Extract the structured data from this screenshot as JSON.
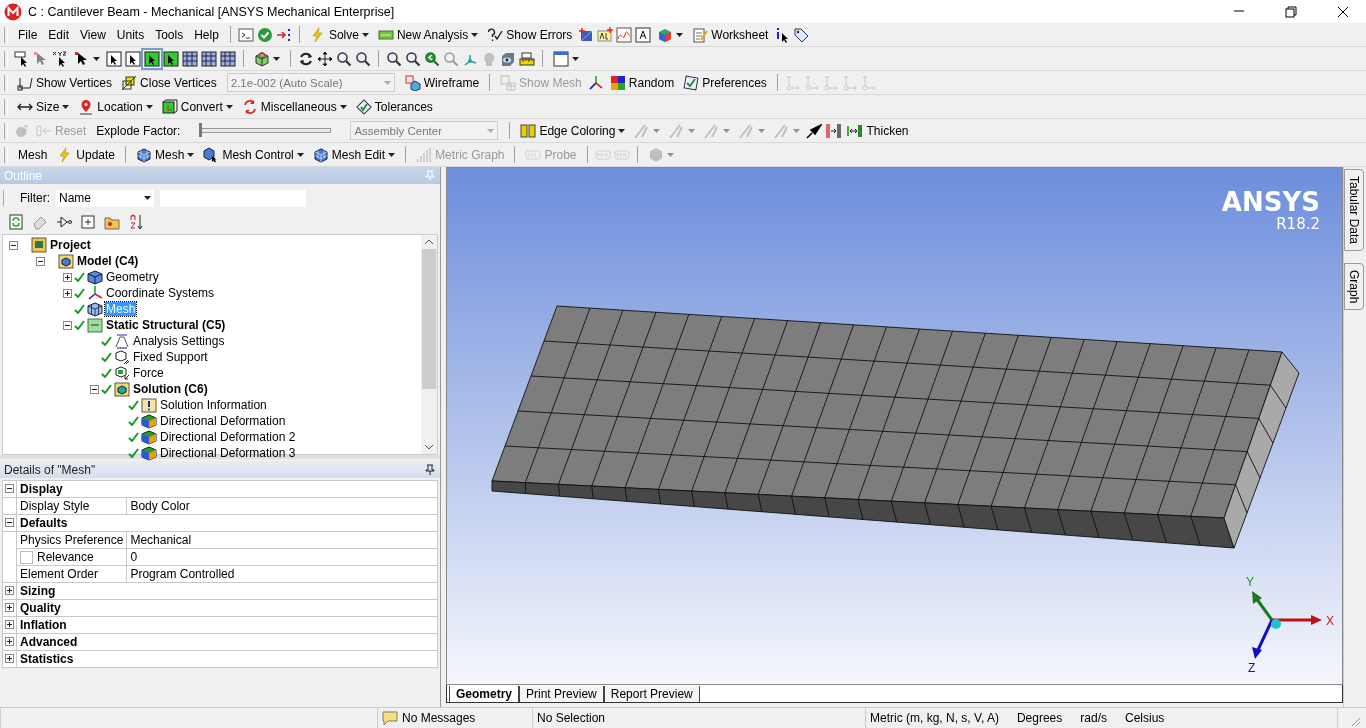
{
  "window": {
    "title": "C : Cantilever Beam - Mechanical [ANSYS Mechanical Enterprise]"
  },
  "toolbars": [
    [
      {
        "kind": "menu",
        "label": "File"
      },
      {
        "kind": "menu",
        "label": "Edit"
      },
      {
        "kind": "menu",
        "label": "View"
      },
      {
        "kind": "menu",
        "label": "Units"
      },
      {
        "kind": "menu",
        "label": "Tools"
      },
      {
        "kind": "menu",
        "label": "Help"
      },
      {
        "kind": "sep"
      },
      {
        "kind": "terminal"
      },
      {
        "kind": "check"
      },
      {
        "kind": "arrows"
      },
      {
        "kind": "sep"
      },
      {
        "kind": "lightning",
        "label": "Solve",
        "caret": true
      },
      {
        "kind": "analysis",
        "label": "New Analysis",
        "caret": true
      },
      {
        "kind": "errors",
        "label": "Show Errors"
      },
      {
        "kind": "annotate"
      },
      {
        "kind": "abc"
      },
      {
        "kind": "graph"
      },
      {
        "kind": "textframe"
      },
      {
        "kind": "colorcube",
        "caret": true
      },
      {
        "kind": "worksheet",
        "label": "Worksheet"
      },
      {
        "kind": "info"
      },
      {
        "kind": "tag"
      }
    ],
    [
      {
        "kind": "labelcursor"
      },
      {
        "kind": "pointer",
        "disabled": true
      },
      {
        "kind": "xyzcursor"
      },
      {
        "kind": "pointer",
        "caret": true
      },
      {
        "kind": "cursorbox"
      },
      {
        "kind": "cursorbox"
      },
      {
        "kind": "greenbox",
        "selected": true
      },
      {
        "kind": "greenbox"
      },
      {
        "kind": "meshbox"
      },
      {
        "kind": "meshbox"
      },
      {
        "kind": "meshbox"
      },
      {
        "kind": "sep"
      },
      {
        "kind": "cube",
        "caret": true
      },
      {
        "kind": "sep"
      },
      {
        "kind": "rotate"
      },
      {
        "kind": "pan"
      },
      {
        "kind": "magnifier"
      },
      {
        "kind": "magnifier"
      },
      {
        "kind": "sep"
      },
      {
        "kind": "magnifier"
      },
      {
        "kind": "magnifier"
      },
      {
        "kind": "zoomfit"
      },
      {
        "kind": "magnifier",
        "disabled": true
      },
      {
        "kind": "iso"
      },
      {
        "kind": "head",
        "disabled": true
      },
      {
        "kind": "eyebox"
      },
      {
        "kind": "ruler"
      },
      {
        "kind": "sep"
      },
      {
        "kind": "window",
        "caret": true
      }
    ],
    [
      {
        "kind": "vertices",
        "label": "Show Vertices"
      },
      {
        "kind": "closevert",
        "label": "Close Vertices"
      },
      {
        "kind": "combo",
        "value": "2.1e-002 (Auto Scale)",
        "disabled": true
      },
      {
        "kind": "wireframe",
        "label": "Wireframe"
      },
      {
        "kind": "sep"
      },
      {
        "kind": "showmesh",
        "label": "Show Mesh",
        "disabled": true
      },
      {
        "kind": "triad"
      },
      {
        "kind": "random",
        "label": "Random"
      },
      {
        "kind": "prefs",
        "label": "Preferences"
      },
      {
        "kind": "sep"
      },
      {
        "kind": "axisdot",
        "disabled": true
      },
      {
        "kind": "axisdot",
        "disabled": true
      },
      {
        "kind": "axisdot",
        "disabled": true
      },
      {
        "kind": "axisdot",
        "disabled": true
      },
      {
        "kind": "axisdot",
        "disabled": true
      }
    ],
    [
      {
        "kind": "size",
        "label": "Size",
        "caret": true
      },
      {
        "kind": "location",
        "label": "Location",
        "caret": true
      },
      {
        "kind": "convert",
        "label": "Convert",
        "caret": true
      },
      {
        "kind": "misc",
        "label": "Miscellaneous",
        "caret": true
      },
      {
        "kind": "tolerance",
        "label": "Tolerances"
      }
    ],
    [
      {
        "kind": "explode",
        "disabled": true
      },
      {
        "kind": "reset",
        "label": "Reset",
        "disabled": true
      },
      {
        "kind": "text",
        "label": "Explode Factor:"
      },
      {
        "kind": "slider",
        "level": 0
      },
      {
        "kind": "combo",
        "value": "Assembly Center",
        "disabled": true
      },
      {
        "kind": "sep"
      },
      {
        "kind": "edgecolor",
        "label": "Edge Coloring",
        "caret": true
      },
      {
        "kind": "edge",
        "caret": true,
        "disabled": true
      },
      {
        "kind": "edge",
        "caret": true,
        "disabled": true
      },
      {
        "kind": "edge",
        "caret": true,
        "disabled": true
      },
      {
        "kind": "edge",
        "caret": true,
        "disabled": true
      },
      {
        "kind": "edge",
        "caret": true,
        "disabled": true
      },
      {
        "kind": "pin"
      },
      {
        "kind": "split"
      },
      {
        "kind": "thicken",
        "label": "Thicken"
      }
    ],
    [
      {
        "kind": "text",
        "label": "Mesh"
      },
      {
        "kind": "lightning",
        "label": "Update"
      },
      {
        "kind": "sep"
      },
      {
        "kind": "meshcube",
        "label": "Mesh",
        "caret": true
      },
      {
        "kind": "meshcontrol",
        "label": "Mesh Control",
        "caret": true
      },
      {
        "kind": "meshcube",
        "label": "Mesh Edit",
        "caret": true
      },
      {
        "kind": "sep"
      },
      {
        "kind": "metric",
        "label": "Metric Graph",
        "disabled": true
      },
      {
        "kind": "sep"
      },
      {
        "kind": "probe",
        "label": "Probe",
        "disabled": true
      },
      {
        "kind": "sep"
      },
      {
        "kind": "maxmin",
        "disabled": true
      },
      {
        "kind": "maxmin",
        "disabled": true
      },
      {
        "kind": "sep"
      },
      {
        "kind": "hexagon",
        "caret": true,
        "disabled": true
      }
    ]
  ],
  "outline": {
    "title": "Outline",
    "filter_label": "Filter:",
    "filter_value": "Name",
    "tree": [
      {
        "kind": "project",
        "label": "Project",
        "expanded": true,
        "solved": false,
        "selected": false,
        "children": [
          {
            "kind": "model",
            "label": "Model (C4)",
            "expanded": true,
            "solved": false,
            "selected": false,
            "children": [
              {
                "kind": "geometry",
                "label": "Geometry",
                "expanded": false,
                "solved": true,
                "selected": false
              },
              {
                "kind": "coordinates",
                "label": "Coordinate Systems",
                "expanded": false,
                "solved": true,
                "selected": false
              },
              {
                "kind": "mesh",
                "label": "Mesh",
                "solved": true,
                "selected": true
              },
              {
                "kind": "analysis",
                "label": "Static Structural (C5)",
                "expanded": true,
                "solved": true,
                "selected": false,
                "children": [
                  {
                    "kind": "settings",
                    "label": "Analysis Settings",
                    "solved": true,
                    "selected": false
                  },
                  {
                    "kind": "support",
                    "label": "Fixed Support",
                    "solved": true,
                    "selected": false
                  },
                  {
                    "kind": "force",
                    "label": "Force",
                    "solved": true,
                    "selected": false
                  },
                  {
                    "kind": "solution",
                    "label": "Solution (C6)",
                    "expanded": true,
                    "solved": true,
                    "selected": false,
                    "children": [
                      {
                        "kind": "info",
                        "label": "Solution Information",
                        "solved": true,
                        "selected": false
                      },
                      {
                        "kind": "result",
                        "label": "Directional Deformation",
                        "solved": true,
                        "selected": false
                      },
                      {
                        "kind": "result",
                        "label": "Directional Deformation 2",
                        "solved": true,
                        "selected": false
                      },
                      {
                        "kind": "result",
                        "label": "Directional Deformation 3",
                        "solved": true,
                        "selected": false
                      }
                    ]
                  }
                ]
              }
            ]
          }
        ]
      }
    ]
  },
  "details": {
    "title": "Details of \"Mesh\"",
    "rows": [
      {
        "kind": "group",
        "label": "Display",
        "expanded": true
      },
      {
        "kind": "property",
        "label": "Display Style",
        "value": "Body Color"
      },
      {
        "kind": "group",
        "label": "Defaults",
        "expanded": true
      },
      {
        "kind": "property",
        "label": "Physics Preference",
        "value": "Mechanical"
      },
      {
        "kind": "checkprop",
        "label": "Relevance",
        "value": "0",
        "checked": false
      },
      {
        "kind": "property",
        "label": "Element Order",
        "value": "Program Controlled"
      },
      {
        "kind": "group",
        "label": "Sizing",
        "expanded": false
      },
      {
        "kind": "group",
        "label": "Quality",
        "expanded": false
      },
      {
        "kind": "group",
        "label": "Inflation",
        "expanded": false
      },
      {
        "kind": "group",
        "label": "Advanced",
        "expanded": false
      },
      {
        "kind": "group",
        "label": "Statistics",
        "expanded": false
      }
    ]
  },
  "viewport": {
    "brand": "ANSYS",
    "version": "R18.2",
    "axes": {
      "x": "X",
      "y": "Y",
      "z": "Z"
    },
    "tabs": [
      {
        "label": "Geometry",
        "selected": true
      },
      {
        "label": "Print Preview",
        "selected": false
      },
      {
        "label": "Report Preview",
        "selected": false
      }
    ]
  },
  "side_tabs": [
    {
      "label": "Tabular Data"
    },
    {
      "label": "Graph"
    }
  ],
  "status_bar": {
    "messages": "No Messages",
    "selection": "No Selection",
    "units": "Metric (m, kg, N, s, V, A)",
    "angle": "Degrees",
    "rate": "rad/s",
    "temperature": "Celsius"
  }
}
